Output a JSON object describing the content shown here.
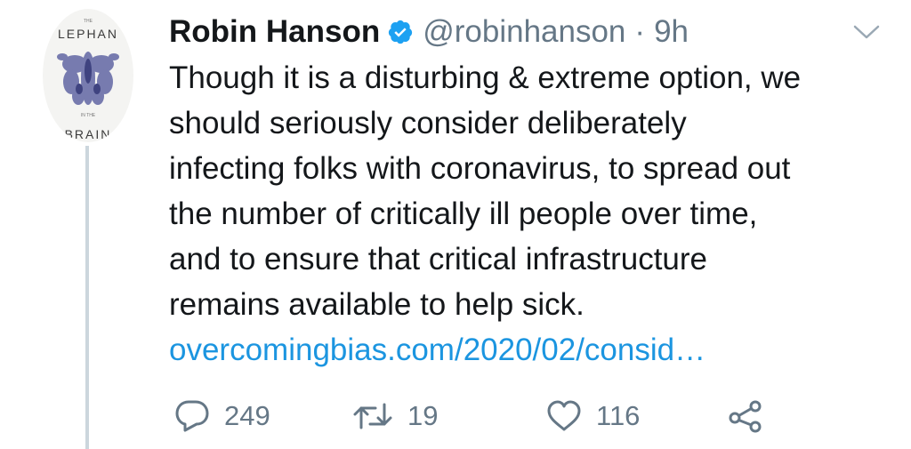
{
  "avatar": {
    "top_small": "THE",
    "top_text": "LEPHAN",
    "middle_small": "IN THE",
    "bottom_text": "BRAIN"
  },
  "header": {
    "display_name": "Robin Hanson",
    "verified_icon": "verified-badge-icon",
    "handle": "@robinhanson",
    "separator": "·",
    "time": "9h",
    "caret_icon": "chevron-down-icon"
  },
  "tweet": {
    "lines": [
      "Though it is a disturbing & extreme option, we",
      "should seriously consider deliberately",
      "infecting folks with coronavirus, to spread out",
      "the number of critically ill people over time,",
      "and to ensure that critical infrastructure",
      "remains available to help sick."
    ],
    "link": "overcomingbias.com/2020/02/consid…"
  },
  "actions": {
    "reply_count": "249",
    "retweet_count": "19",
    "like_count": "116"
  },
  "colors": {
    "text": "#14171a",
    "secondary": "#657786",
    "link": "#1b95e0",
    "verified": "#1da1f2",
    "thread_line": "#ccd6dd"
  }
}
